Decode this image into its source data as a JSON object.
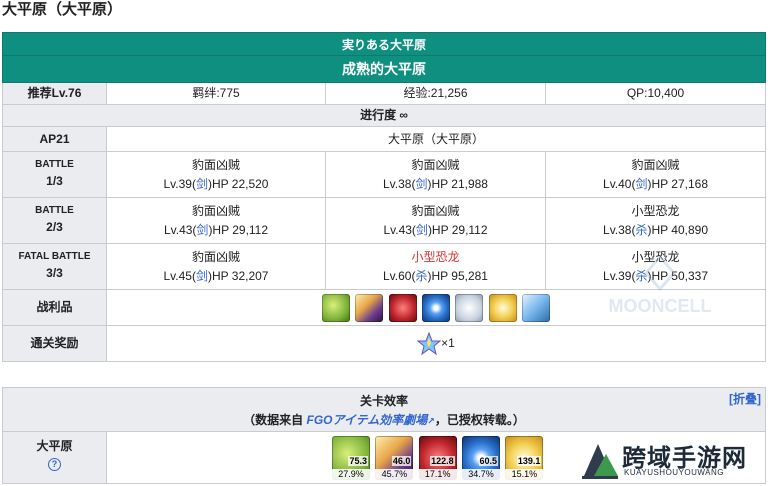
{
  "page_title": "大平原（大平原）",
  "quest": {
    "title_jp": "実りある大平原",
    "title_cn": "成熟的大平原",
    "recommend_label": "推荐Lv.76",
    "bond": "羁绊:775",
    "exp": "经验:21,256",
    "qp": "QP:10,400",
    "progress": "进行度 ∞",
    "ap": "AP21",
    "location": "大平原（大平原）",
    "battles": [
      {
        "label": "BATTLE",
        "wave": "1/3",
        "enemies": [
          {
            "name": "豹面凶贼",
            "lv": "Lv.39(",
            "cls": "剑",
            "hp": ")HP 22,520",
            "color": "#202122"
          },
          {
            "name": "豹面凶贼",
            "lv": "Lv.38(",
            "cls": "剑",
            "hp": ")HP 21,988",
            "color": "#202122"
          },
          {
            "name": "豹面凶贼",
            "lv": "Lv.40(",
            "cls": "剑",
            "hp": ")HP 27,168",
            "color": "#202122"
          }
        ]
      },
      {
        "label": "BATTLE",
        "wave": "2/3",
        "enemies": [
          {
            "name": "豹面凶贼",
            "lv": "Lv.43(",
            "cls": "剑",
            "hp": ")HP 29,112",
            "color": "#202122"
          },
          {
            "name": "豹面凶贼",
            "lv": "Lv.43(",
            "cls": "剑",
            "hp": ")HP 29,112",
            "color": "#202122"
          },
          {
            "name": "小型恐龙",
            "lv": "Lv.38(",
            "cls": "杀",
            "hp": ")HP 40,890",
            "color": "#202122"
          }
        ]
      },
      {
        "label": "FATAL BATTLE",
        "wave": "3/3",
        "enemies": [
          {
            "name": "豹面凶贼",
            "lv": "Lv.45(",
            "cls": "剑",
            "hp": ")HP 32,207",
            "color": "#202122"
          },
          {
            "name": "小型恐龙",
            "lv": "Lv.60(",
            "cls": "杀",
            "hp": ")HP 95,281",
            "color": "#d33333"
          },
          {
            "name": "小型恐龙",
            "lv": "Lv.39(",
            "cls": "杀",
            "hp": ")HP 50,337",
            "color": "#202122"
          }
        ]
      }
    ],
    "drops_label": "战利品",
    "drops": [
      {
        "icon": "green-seed-icon",
        "color": "#7bb13a"
      },
      {
        "icon": "purple-claw-icon",
        "color": "#6a3d8c"
      },
      {
        "icon": "red-gem-icon",
        "color": "#c0262d"
      },
      {
        "icon": "blue-orb-icon",
        "color": "#2a6fc9"
      },
      {
        "icon": "silver-dust-icon",
        "color": "#c9d3e0"
      },
      {
        "icon": "gold-shiny-icon",
        "color": "#e8b92a"
      },
      {
        "icon": "blue-crystal-icon",
        "color": "#78b7ec"
      }
    ],
    "clear_reward_label": "通关奖励",
    "clear_reward": "×1"
  },
  "efficiency": {
    "title": "关卡效率",
    "collapse": "[折叠]",
    "source_prefix": "（数据来自 ",
    "source_link": "FGOアイテム効率劇場",
    "source_suffix": "，已授权转载。）",
    "row_label": "大平原",
    "help_icon": "?",
    "items": [
      {
        "icon": "green-seed-icon",
        "value": "75.3",
        "percent": "27.9%",
        "color": "#7bb13a"
      },
      {
        "icon": "purple-claw-icon",
        "value": "46.0",
        "percent": "45.7%",
        "color": "#6a3d8c"
      },
      {
        "icon": "red-gem-icon",
        "value": "122.8",
        "percent": "17.1%",
        "color": "#c0262d"
      },
      {
        "icon": "blue-orb-icon",
        "value": "60.5",
        "percent": "34.7%",
        "color": "#2a6fc9"
      },
      {
        "icon": "gold-shiny-icon",
        "value": "139.1",
        "percent": "15.1%",
        "color": "#e8b92a"
      }
    ]
  },
  "watermark": "MOONCELL",
  "site_logo": {
    "cn": "跨域手游网",
    "en": "KUAYUSHOUYOUWANG"
  }
}
